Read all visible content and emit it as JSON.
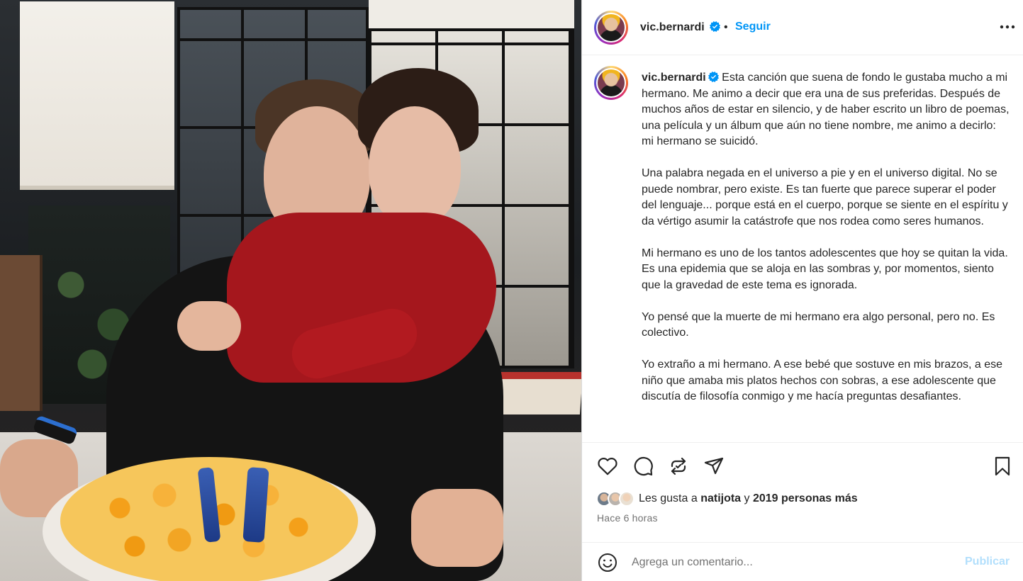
{
  "post": {
    "username": "vic.bernardi",
    "follow_label": "Seguir",
    "separator": "•",
    "caption_paragraphs": [
      "Esta canción que suena de fondo le gustaba mucho a mi hermano. Me animo a decir que era una de sus preferidas. Después de muchos años de estar en silencio, y de haber escrito un libro de poemas, una película y un álbum que aún no tiene nombre, me animo a decirlo: mi hermano se suicidó.",
      "Una palabra negada en el universo a pie y en el universo digital. No se puede nombrar, pero existe. Es tan fuerte que parece superar el poder del lenguaje... porque está en el cuerpo, porque se siente en el espíritu y da vértigo asumir la catástrofe que nos rodea como seres humanos.",
      "Mi hermano es uno de los tantos adolescentes que hoy se quitan la vida. Es una epidemia que se aloja en las sombras y, por momentos, siento que la gravedad de este tema es ignorada.",
      "Yo pensé que la muerte de mi hermano era algo personal, pero no. Es colectivo.",
      "Yo extraño a mi hermano. A ese bebé que sostuve en mis brazos, a ese niño que amaba mis platos hechos con sobras, a ese adolescente que discutía de filosofía conmigo y me hacía preguntas desafiantes."
    ],
    "likes": {
      "prefix": "Les gusta a",
      "user": "natijota",
      "connector": "y",
      "others": "2019 personas más"
    },
    "time_ago": "Hace 6 horas",
    "comment_placeholder": "Agrega un comentario...",
    "publish_label": "Publicar"
  },
  "icons": {
    "more": "more-options-icon",
    "verified": "verified-badge-icon",
    "like": "heart-icon",
    "comment": "comment-bubble-icon",
    "repost": "repost-icon",
    "share": "send-icon",
    "save": "bookmark-icon",
    "emoji": "emoji-icon"
  },
  "colors": {
    "link_blue": "#0095f6",
    "publish_disabled": "#b2dffc",
    "muted_text": "#737373",
    "verified_blue": "#0095f6"
  }
}
